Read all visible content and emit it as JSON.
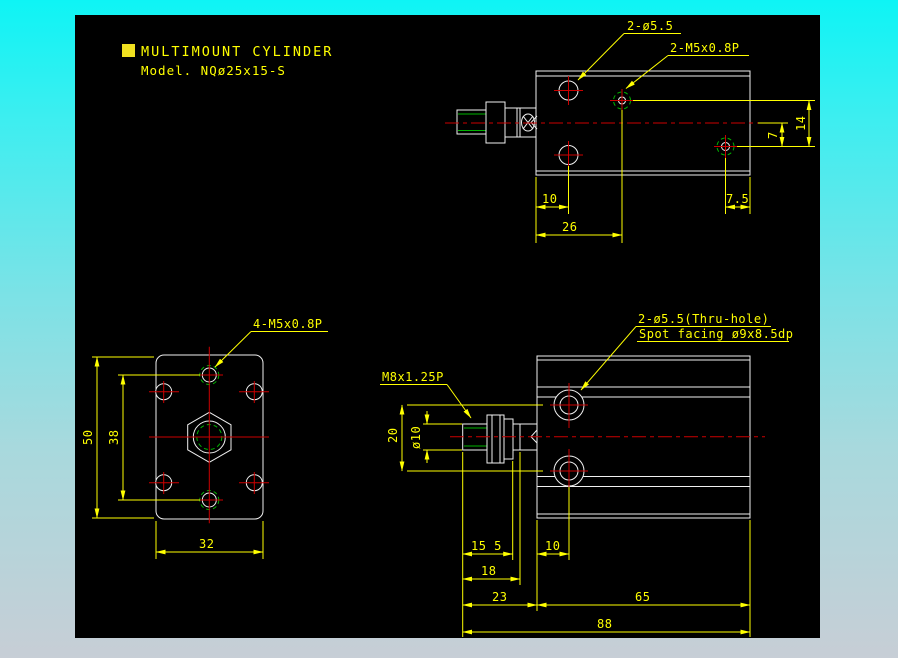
{
  "title_block": {
    "heading": "MULTIMOUNT CYLINDER",
    "model_line": "Model. NQø25x15-S"
  },
  "colors": {
    "gradient_top": "#0ef4f5",
    "gradient_bottom": "#c7ced6",
    "canvas_background": "#000000",
    "geometry": "#f0f0f0",
    "dimensions": "#ffff00",
    "centerlines": "#cc0000",
    "threads": "#00b400"
  },
  "top_view": {
    "labels": {
      "holes": "2-ø5.5",
      "taps": "2-M5x0.8P"
    },
    "dims": {
      "hole_offset": "10",
      "tap_offset": "26",
      "port_edge_offset": "7.5",
      "port_center_offset": "7",
      "tap_to_port": "14"
    }
  },
  "front_view": {
    "labels": {
      "taps": "4-M5x0.8P"
    },
    "dims": {
      "height": "50",
      "hole_spacing": "38",
      "width": "32"
    }
  },
  "side_view": {
    "labels": {
      "thru_hole": "2-ø5.5(Thru-hole)",
      "spot_facing": "Spot facing ø9x8.5dp",
      "rod_thread": "M8x1.25P"
    },
    "dims": {
      "hole_spacing": "20",
      "rod_dia": "ø10",
      "rod_length": "15 5",
      "rod_assembly": "18",
      "hole_offset": "10",
      "rod_total": "23",
      "body_length": "65",
      "total_length": "88"
    }
  }
}
